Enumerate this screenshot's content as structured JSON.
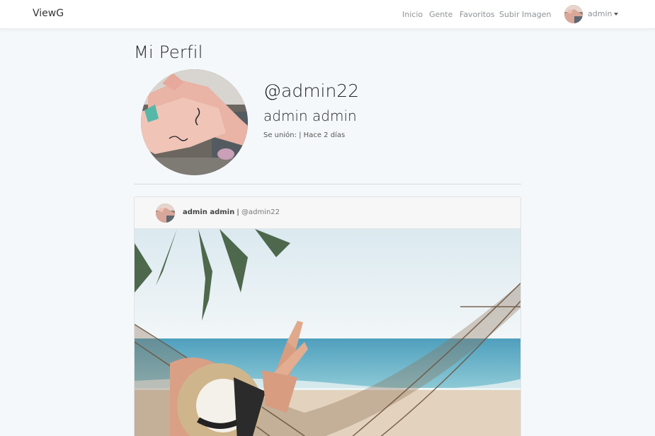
{
  "navbar": {
    "brand": "ViewG",
    "links": [
      "Inicio",
      "Gente",
      "Favoritos",
      "Subir Imagen"
    ],
    "user_label": "admin"
  },
  "profile": {
    "page_title": "Mi Perfil",
    "username": "@admin22",
    "full_name": "admin admin",
    "joined_text": "Se unión: | Hace 2 días"
  },
  "post": {
    "author_name": "admin admin",
    "separator": " | ",
    "author_handle": "@admin22"
  },
  "colors": {
    "background": "#f5f8fa",
    "navbar_bg": "#ffffff",
    "nav_link": "#8f9396",
    "card_header_bg": "#f7f7f7"
  }
}
